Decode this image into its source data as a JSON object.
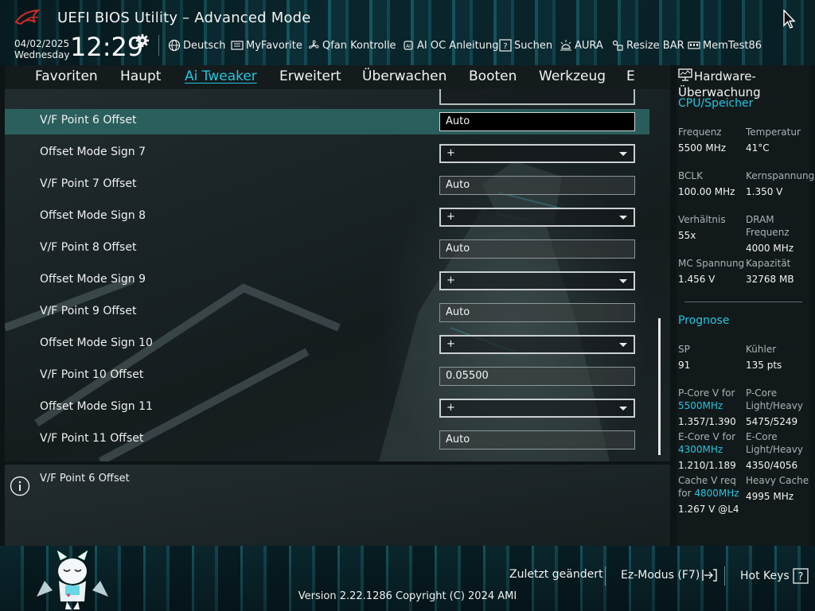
{
  "header": {
    "title": "UEFI BIOS Utility – Advanced Mode",
    "date": "04/02/2025",
    "weekday": "Wednesday",
    "time": "12:29",
    "toolbar": [
      {
        "label": "Deutsch",
        "icon": "globe-icon"
      },
      {
        "label": "MyFavorite",
        "icon": "favorite-list-icon"
      },
      {
        "label": "Qfan Kontrolle",
        "icon": "fan-icon"
      },
      {
        "label": "AI OC Anleitung",
        "icon": "ai-chip-icon"
      },
      {
        "label": "Suchen",
        "icon": "search-help-icon"
      },
      {
        "label": "AURA",
        "icon": "aura-light-icon"
      },
      {
        "label": "Resize BAR",
        "icon": "resize-bar-icon"
      },
      {
        "label": "MemTest86",
        "icon": "memory-icon"
      }
    ]
  },
  "menu": {
    "tabs": [
      {
        "label": "Favoriten"
      },
      {
        "label": "Haupt"
      },
      {
        "label": "Ai Tweaker",
        "active": true
      },
      {
        "label": "Erweitert"
      },
      {
        "label": "Überwachen"
      },
      {
        "label": "Booten"
      },
      {
        "label": "Werkzeug"
      },
      {
        "label": "E"
      }
    ]
  },
  "settings": {
    "rows": [
      {
        "label": "V/F Point 6 Offset",
        "value": "Auto",
        "type": "text",
        "focused": true
      },
      {
        "label": "Offset Mode Sign 7",
        "value": "+",
        "type": "select"
      },
      {
        "label": "V/F Point 7 Offset",
        "value": "Auto",
        "type": "text"
      },
      {
        "label": "Offset Mode Sign 8",
        "value": "+",
        "type": "select"
      },
      {
        "label": "V/F Point 8 Offset",
        "value": "Auto",
        "type": "text"
      },
      {
        "label": "Offset Mode Sign 9",
        "value": "+",
        "type": "select"
      },
      {
        "label": "V/F Point 9 Offset",
        "value": "Auto",
        "type": "text"
      },
      {
        "label": "Offset Mode Sign 10",
        "value": "+",
        "type": "select"
      },
      {
        "label": "V/F Point 10 Offset",
        "value": "0.05500",
        "type": "text"
      },
      {
        "label": "Offset Mode Sign 11",
        "value": "+",
        "type": "select"
      },
      {
        "label": "V/F Point 11 Offset",
        "value": "Auto",
        "type": "text"
      }
    ]
  },
  "info": {
    "text": "V/F Point 6 Offset"
  },
  "hardware_monitor": {
    "title": "Hardware-Überwachung",
    "cpu_section": "CPU/Speicher",
    "cpu": {
      "freq_label": "Frequenz",
      "freq_value": "5500 MHz",
      "temp_label": "Temperatur",
      "temp_value": "41°C",
      "bclk_label": "BCLK",
      "bclk_value": "100.00 MHz",
      "vcore_label": "Kernspannung",
      "vcore_value": "1.350 V",
      "ratio_label": "Verhältnis",
      "ratio_value": "55x",
      "dram_label": "DRAM Frequenz",
      "dram_value": "4000 MHz",
      "mc_label": "MC Spannung",
      "mc_value": "1.456 V",
      "cap_label": "Kapazität",
      "cap_value": "32768 MB"
    },
    "prognose_section": "Prognose",
    "prognose": {
      "sp_label": "SP",
      "sp_value": "91",
      "cooler_label": "Kühler",
      "cooler_value": "135 pts",
      "pcore_v_label": "P-Core V for",
      "pcore_v_freq": "5500MHz",
      "pcore_v_value": "1.357/1.390",
      "pcore_lh_label": "P-Core Light/Heavy",
      "pcore_lh_value": "5475/5249",
      "ecore_v_label": "E-Core V for",
      "ecore_v_freq": "4300MHz",
      "ecore_v_value": "1.210/1.189",
      "ecore_lh_label": "E-Core Light/Heavy",
      "ecore_lh_value": "4350/4056",
      "cache_v_label": "Cache V req",
      "cache_v_for": "for",
      "cache_v_freq": "4800MHz",
      "cache_v_value": "1.267 V @L4",
      "heavy_cache_label": "Heavy Cache",
      "heavy_cache_value": "4995 MHz"
    }
  },
  "footer": {
    "last_modified": "Zuletzt geändert",
    "ez_mode": "Ez-Modus (F7)",
    "hot_keys": "Hot Keys",
    "version": "Version 2.22.1286 Copyright (C) 2024 AMI"
  },
  "colors": {
    "accent": "#27c4dc",
    "highlight_row": "#2e6e6c",
    "panel_bg": "#12191b"
  }
}
